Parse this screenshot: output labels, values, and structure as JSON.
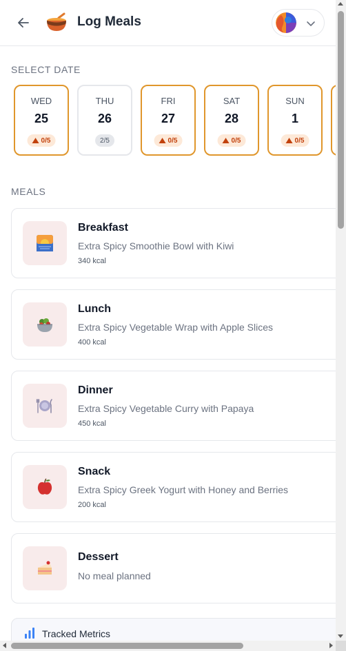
{
  "header": {
    "title": "Log Meals",
    "back_icon": "arrow-left-icon",
    "logo_icon": "bowl-icon",
    "profile_dropdown_icon": "chevron-down-icon"
  },
  "date_section": {
    "label": "SELECT DATE",
    "days": [
      {
        "name": "WED",
        "num": "25",
        "badge": "0/5",
        "status": "warn"
      },
      {
        "name": "THU",
        "num": "26",
        "badge": "2/5",
        "status": "normal"
      },
      {
        "name": "FRI",
        "num": "27",
        "badge": "0/5",
        "status": "warn"
      },
      {
        "name": "SAT",
        "num": "28",
        "badge": "0/5",
        "status": "warn"
      },
      {
        "name": "SUN",
        "num": "1",
        "badge": "0/5",
        "status": "warn"
      }
    ]
  },
  "meals_section": {
    "label": "MEALS",
    "meals": [
      {
        "title": "Breakfast",
        "desc": "Extra Spicy Smoothie Bowl with Kiwi",
        "kcal": "340 kcal",
        "icon": "sunrise-icon"
      },
      {
        "title": "Lunch",
        "desc": "Extra Spicy Vegetable Wrap with Apple Slices",
        "kcal": "400 kcal",
        "icon": "salad-bowl-icon"
      },
      {
        "title": "Dinner",
        "desc": "Extra Spicy Vegetable Curry with Papaya",
        "kcal": "450 kcal",
        "icon": "plate-cutlery-icon"
      },
      {
        "title": "Snack",
        "desc": "Extra Spicy Greek Yogurt with Honey and Berries",
        "kcal": "200 kcal",
        "icon": "apple-icon"
      },
      {
        "title": "Dessert",
        "desc": "No meal planned",
        "kcal": "",
        "icon": "cake-slice-icon"
      }
    ]
  },
  "metrics": {
    "label": "Tracked Metrics",
    "icon": "bar-chart-icon"
  },
  "colors": {
    "warn_border": "#e0962b",
    "warn_badge_bg": "#fde9d8",
    "warn_text": "#c2410c",
    "meal_icon_bg": "#f8ebeb"
  }
}
